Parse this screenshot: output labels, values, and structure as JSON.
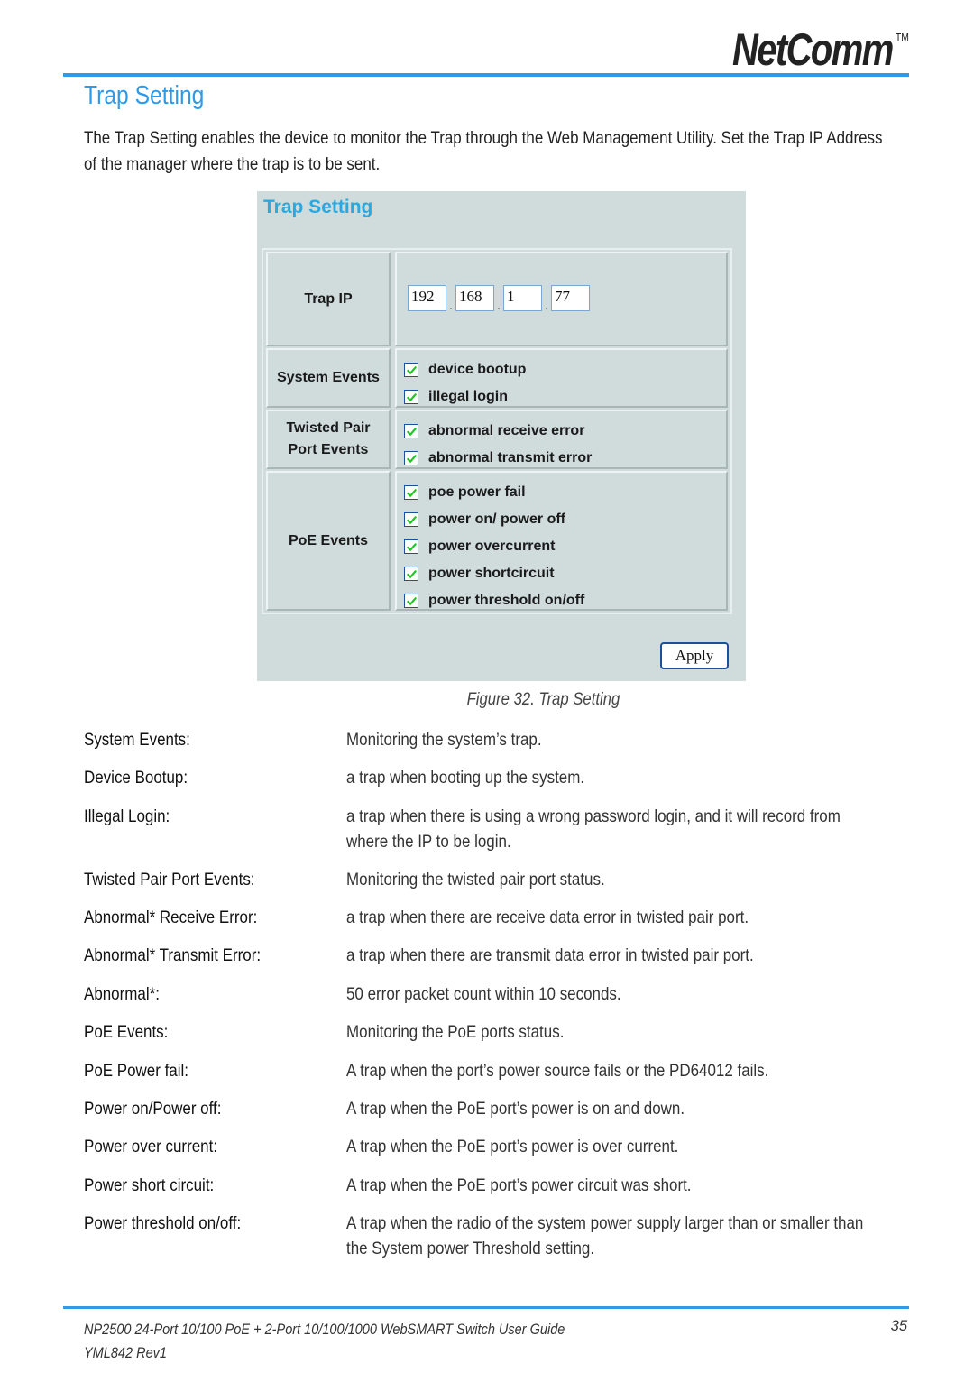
{
  "header": {
    "logo_text": "NetComm",
    "logo_tm": "TM",
    "accent_color": "#2f9be8"
  },
  "page": {
    "title": "Trap Setting",
    "intro": "The Trap Setting enables the device to monitor the Trap through the Web Management Utility. Set the Trap IP Address of the manager where the trap is to be sent."
  },
  "screenshot": {
    "title": "Trap Setting",
    "trap_ip": {
      "label": "Trap IP",
      "octets": [
        "192",
        "168",
        "1",
        "77"
      ],
      "separator": "."
    },
    "groups": [
      {
        "label_line1": "System Events",
        "label_line2": "",
        "options": [
          {
            "label": "device bootup",
            "checked": true
          },
          {
            "label": "illegal login",
            "checked": true
          }
        ]
      },
      {
        "label_line1": "Twisted Pair",
        "label_line2": "Port Events",
        "options": [
          {
            "label": "abnormal receive error",
            "checked": true
          },
          {
            "label": "abnormal transmit error",
            "checked": true
          }
        ]
      },
      {
        "label_line1": "PoE Events",
        "label_line2": "",
        "options": [
          {
            "label": "poe power fail",
            "checked": true
          },
          {
            "label": "power on/ power off",
            "checked": true
          },
          {
            "label": "power overcurrent",
            "checked": true
          },
          {
            "label": "power shortcircuit",
            "checked": true
          },
          {
            "label": "power threshold on/off",
            "checked": true
          }
        ]
      }
    ],
    "apply_label": "Apply"
  },
  "caption": "Figure 32. Trap Setting",
  "definitions": [
    {
      "term": "System Events:",
      "desc": "Monitoring the system’s trap."
    },
    {
      "term": "Device Bootup:",
      "desc": "a trap when booting up the system."
    },
    {
      "term": "Illegal Login:",
      "desc": "a trap when there is using a wrong password login, and it will record from where the IP to be login."
    },
    {
      "term": " Twisted Pair Port Events:",
      "desc": "Monitoring the twisted pair port status."
    },
    {
      "term": "Abnormal* Receive Error:",
      "desc": "a trap when there are receive data error in twisted pair port."
    },
    {
      "term": "Abnormal* Transmit Error:",
      "desc": "a trap when there are transmit data error in twisted pair port."
    },
    {
      "term": "Abnormal*:",
      "desc": "50 error packet count within 10 seconds."
    },
    {
      "term": "PoE Events:",
      "desc": "Monitoring the PoE ports status."
    },
    {
      "term": "PoE Power fail:",
      "desc": "A trap when the port’s power source fails or the PD64012 fails."
    },
    {
      "term": "Power on/Power off:",
      "desc": " A trap when the PoE port’s power is on and down."
    },
    {
      "term": "Power over current:",
      "desc": "A trap when the PoE port’s power is over current."
    },
    {
      "term": "Power short circuit:",
      "desc": "A trap when the PoE port’s power circuit was short."
    },
    {
      "term": "Power threshold on/off:",
      "desc": "A trap when the radio of the system power supply larger than or smaller than the System power Threshold setting."
    }
  ],
  "footer": {
    "guide_title": "NP2500 24-Port 10/100 PoE + 2-Port 10/100/1000 WebSMART Switch User Guide",
    "doc_code": "YML842 Rev1",
    "page_number": "35"
  }
}
